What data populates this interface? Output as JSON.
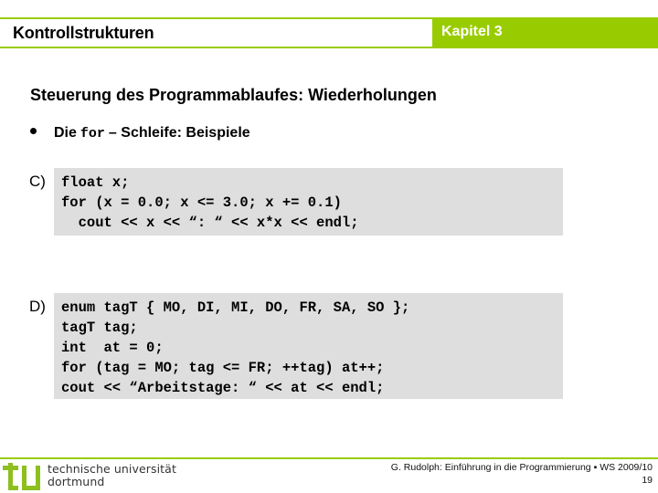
{
  "header": {
    "title": "Kontrollstrukturen",
    "chapter": "Kapitel 3",
    "accent_color": "#99cc00"
  },
  "content": {
    "section_title": "Steuerung des Programmablaufes: Wiederholungen",
    "bullet": {
      "prefix": "Die",
      "code": "for",
      "suffix": "– Schleife: Beispiele"
    },
    "examples": [
      {
        "label": "C)",
        "code_lines": [
          "float x;",
          "for (x = 0.0; x <= 3.0; x += 0.1)",
          "  cout << x << “: “ << x*x << endl;"
        ]
      },
      {
        "label": "D)",
        "code_lines": [
          "enum tagT { MO, DI, MI, DO, FR, SA, SO };",
          "tagT tag;",
          "int  at = 0;",
          "for (tag = MO; tag <= FR; ++tag) at++;",
          "cout << “Arbeitstage: “ << at << endl;"
        ]
      }
    ]
  },
  "footer": {
    "logo_icon": "tu-logo-icon",
    "university_line1": "technische universität",
    "university_line2": "dortmund",
    "credit": "G. Rudolph: Einführung in die Programmierung ▪ WS 2009/10",
    "page_number": "19"
  }
}
